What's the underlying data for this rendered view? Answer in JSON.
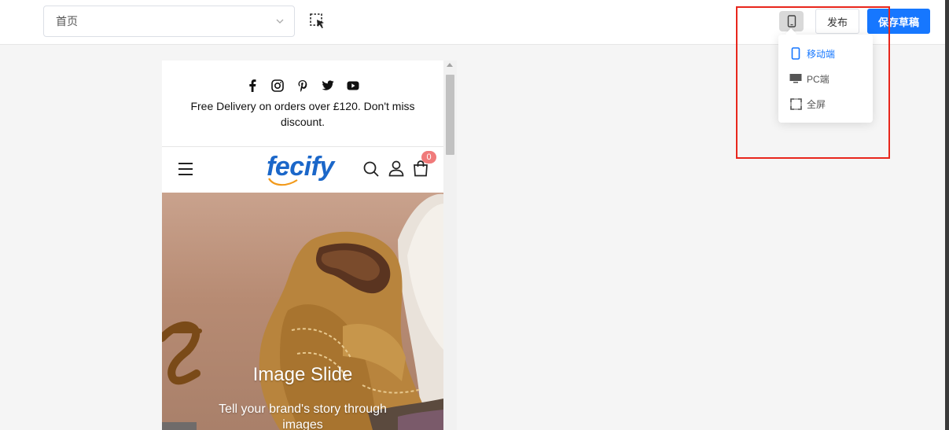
{
  "toolbar": {
    "page_select_value": "首页",
    "publish_label": "发布",
    "save_label": "保存草稿",
    "device_menu": [
      {
        "label": "移动端",
        "icon": "mobile-icon",
        "active": true
      },
      {
        "label": "PC端",
        "icon": "desktop-icon",
        "active": false
      },
      {
        "label": "全屏",
        "icon": "fullscreen-icon",
        "active": false
      }
    ]
  },
  "preview": {
    "social_icons": [
      "facebook-icon",
      "instagram-icon",
      "pinterest-icon",
      "twitter-icon",
      "youtube-icon"
    ],
    "announcement": "Free Delivery on orders over £120. Don't miss discount.",
    "logo_text": "fecify",
    "cart_count": "0",
    "hero_title": "Image Slide",
    "hero_subtitle": "Tell your brand's story through images"
  },
  "colors": {
    "accent": "#1677ff",
    "highlight": "#e8261c",
    "logo": "#1b67c9",
    "cart_badge": "#f07a7a"
  }
}
